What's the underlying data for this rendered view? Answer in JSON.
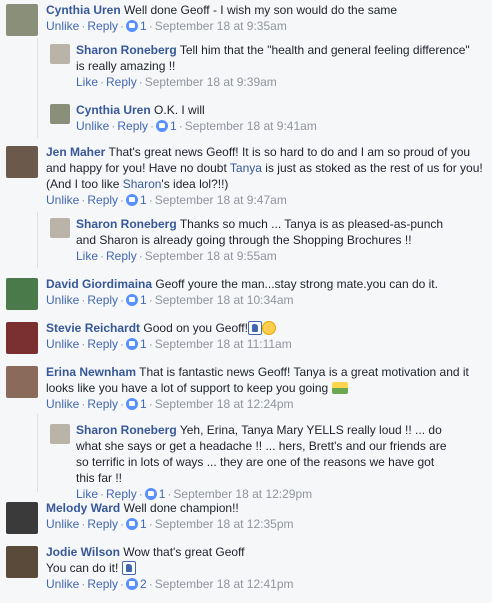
{
  "meta_labels": {
    "unlike": "Unlike",
    "like": "Like",
    "reply": "Reply",
    "dot": "·"
  },
  "comments": [
    {
      "name": "Cynthia Uren",
      "text": "Well done Geoff - I wish my son would do the same",
      "action": "Unlike",
      "likes": "1",
      "time": "September 18 at 9:35am",
      "avatar_color": "#8a8f7a"
    },
    {
      "name": "Sharon Roneberg",
      "text": "Tell him that the \"health and general feeling difference\" is really amazing !!",
      "action": "Like",
      "likes": "",
      "time": "September 18 at 9:39am",
      "avatar_color": "#b9b3a8"
    },
    {
      "name": "Cynthia Uren",
      "text": "O.K. I will",
      "action": "Unlike",
      "likes": "1",
      "time": "September 18 at 9:41am",
      "avatar_color": "#8a8f7a"
    },
    {
      "name": "Jen Maher",
      "text_before_tanya": "That's great news Geoff! It is so hard to do and I am so proud of you and happy for you! Have no doubt ",
      "tanya": "Tanya",
      "text_middle": " is just as stoked as the rest of us for you! (And I too like ",
      "sharon": "Sharon",
      "text_after": "'s idea lol?!!)",
      "action": "Unlike",
      "likes": "1",
      "time": "September 18 at 9:47am",
      "avatar_color": "#6b5a4c"
    },
    {
      "name": "Sharon Roneberg",
      "text": "Thanks so much ... Tanya is as pleased-as-punch and Sharon is already going through the Shopping Brochures !!",
      "action": "Like",
      "likes": "",
      "time": "September 18 at 9:55am",
      "avatar_color": "#b9b3a8"
    },
    {
      "name": "David Giordimaina",
      "text": "Geoff youre the man...stay strong mate.you can do it.",
      "action": "Unlike",
      "likes": "1",
      "time": "September 18 at 10:34am",
      "avatar_color": "#4a7a4a"
    },
    {
      "name": "Stevie Reichardt",
      "text": "Good on you Geoff!",
      "action": "Unlike",
      "likes": "1",
      "time": "September 18 at 11:11am",
      "avatar_color": "#7a3030"
    },
    {
      "name": "Erina Newnham",
      "text": "That is fantastic news Geoff! Tanya is a great motivation and it looks like you have a lot of support to keep you going",
      "action": "Unlike",
      "likes": "1",
      "time": "September 18 at 12:24pm",
      "avatar_color": "#8a6a5a"
    },
    {
      "name": "Sharon Roneberg",
      "text": "Yeh, Erina, Tanya Mary YELLS really loud !! ... do what she says or get a headache !! ... hers, Brett's and our friends are so terrific in lots of ways ... they are one of the reasons we have got this far !!",
      "action": "Like",
      "likes": "1",
      "time": "September 18 at 12:29pm",
      "avatar_color": "#b9b3a8"
    },
    {
      "name": "Melody Ward",
      "text": "Well done champion!!",
      "action": "Unlike",
      "likes": "1",
      "time": "September 18 at 12:35pm",
      "avatar_color": "#3a3a3a"
    },
    {
      "name": "Jodie Wilson",
      "text": "Wow that's great Geoff",
      "text2": "You can do it!",
      "action": "Unlike",
      "likes": "2",
      "time": "September 18 at 12:41pm",
      "avatar_color": "#5a4a3a"
    }
  ]
}
